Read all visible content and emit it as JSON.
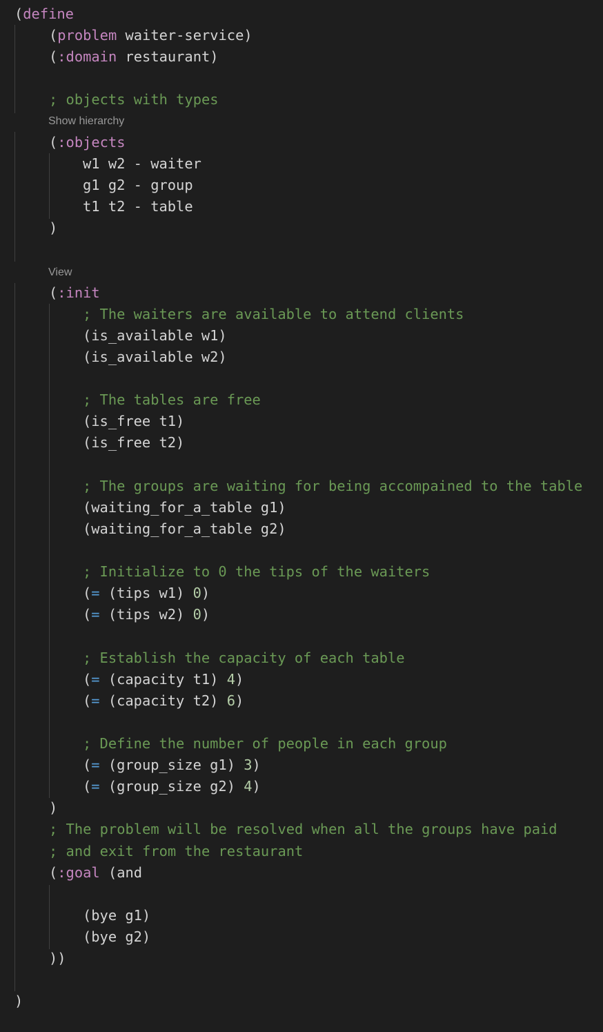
{
  "code": {
    "define_open": {
      "paren": "(",
      "keyword": "define"
    },
    "problem": {
      "paren": "(",
      "keyword": "problem",
      "name": " waiter-service",
      "close": ")"
    },
    "domain": {
      "paren": "(",
      "keyword": ":domain",
      "name": " restaurant",
      "close": ")"
    },
    "comment_objects": "; objects with types",
    "lens_show_hierarchy": "Show hierarchy",
    "objects_open": {
      "paren": "(",
      "keyword": ":objects"
    },
    "objects_lines": [
      "w1 w2 - waiter",
      "g1 g2 - group",
      "t1 t2 - table"
    ],
    "objects_close": ")",
    "lens_view": "View",
    "init_open": {
      "paren": "(",
      "keyword": ":init"
    },
    "comment_waiters": "; The waiters are available to attend clients",
    "avail_w1": "(is_available w1)",
    "avail_w2": "(is_available w2)",
    "comment_tables": "; The tables are free",
    "free_t1": "(is_free t1)",
    "free_t2": "(is_free t2)",
    "comment_groups": "; The groups are waiting for being accompained to the table",
    "waiting_g1": "(waiting_for_a_table g1)",
    "waiting_g2": "(waiting_for_a_table g2)",
    "comment_tips": "; Initialize to 0 the tips of the waiters",
    "tips_w1": {
      "open": "(",
      "eq": "=",
      "expr": " (tips w1) ",
      "num": "0",
      "close": ")"
    },
    "tips_w2": {
      "open": "(",
      "eq": "=",
      "expr": " (tips w2) ",
      "num": "0",
      "close": ")"
    },
    "comment_capacity": "; Establish the capacity of each table",
    "cap_t1": {
      "open": "(",
      "eq": "=",
      "expr": " (capacity t1) ",
      "num": "4",
      "close": ")"
    },
    "cap_t2": {
      "open": "(",
      "eq": "=",
      "expr": " (capacity t2) ",
      "num": "6",
      "close": ")"
    },
    "comment_people": "; Define the number of people in each group",
    "size_g1": {
      "open": "(",
      "eq": "=",
      "expr": " (group_size g1) ",
      "num": "3",
      "close": ")"
    },
    "size_g2": {
      "open": "(",
      "eq": "=",
      "expr": " (group_size g2) ",
      "num": "4",
      "close": ")"
    },
    "init_close": ")",
    "comment_goal_1": "; The problem will be resolved when all the groups have paid",
    "comment_goal_2": "; and exit from the restaurant",
    "goal_open": {
      "paren": "(",
      "keyword": ":goal",
      "rest": " (and"
    },
    "bye_g1": "(bye g1)",
    "bye_g2": "(bye g2)",
    "goal_close": "))",
    "define_close": ")"
  },
  "colors": {
    "background": "#1e1e1e",
    "keyword": "#c586c0",
    "comment": "#6a9955",
    "operator": "#569cd6",
    "number": "#b5cea8",
    "text": "#d4d4d4",
    "lens": "#999999",
    "indent_guide": "#404040"
  }
}
